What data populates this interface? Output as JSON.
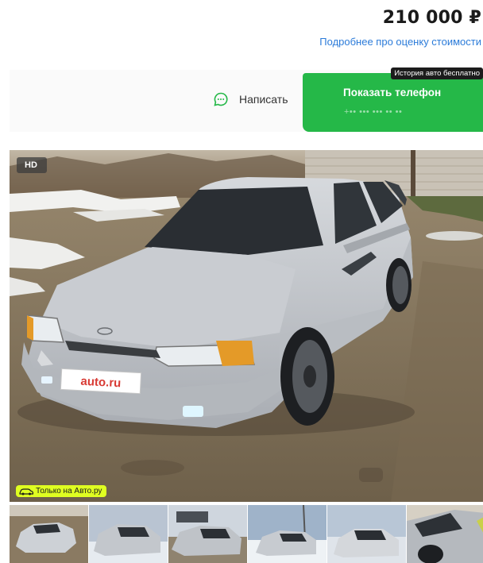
{
  "price": {
    "value": "210 000 ₽",
    "estimate_link": "Подробнее про оценку стоимости"
  },
  "actions": {
    "write_label": "Написать",
    "phone_label": "Показать телефон",
    "phone_masked": "+•• ••• ••• •• ••",
    "history_badge": "История авто бесплатно"
  },
  "photo": {
    "hd_badge": "HD",
    "exclusive_badge": "Только на Авто.ру",
    "plate_text": "auto.ru"
  },
  "thumbnails": {
    "count": 6
  },
  "colors": {
    "primary_button": "#25b848",
    "link": "#2b7bd9",
    "exclusive_badge": "#dfff21"
  },
  "icons": [
    "chat-icon",
    "car-icon"
  ]
}
